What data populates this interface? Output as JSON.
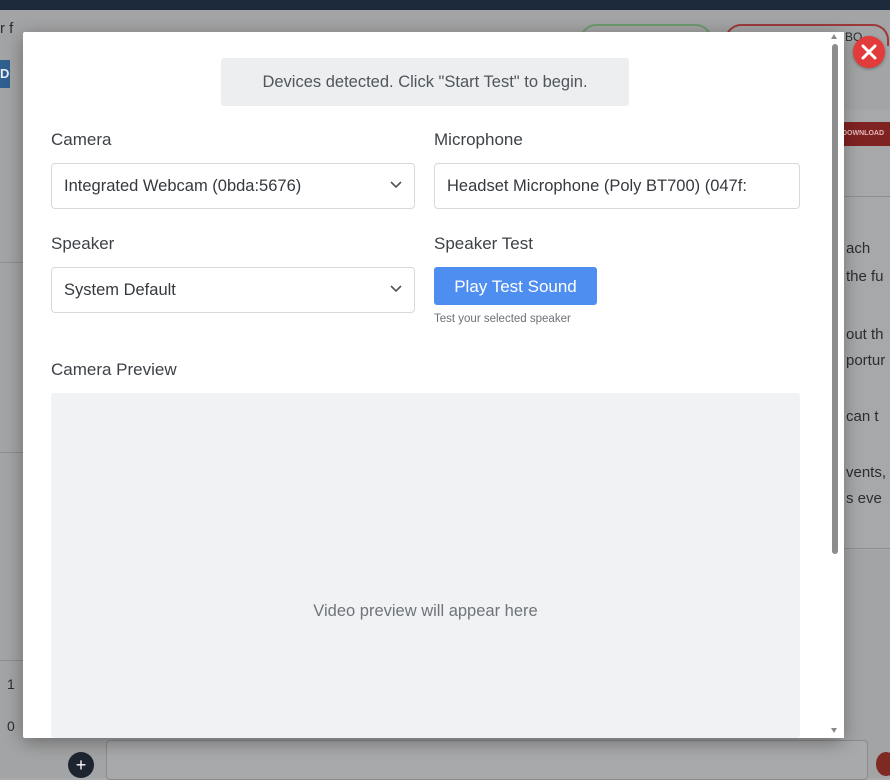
{
  "background": {
    "left_fragments": [
      "r f",
      "DC",
      "1",
      "0"
    ],
    "right_fragments": [
      "ach",
      "the fu",
      "out th",
      "portur",
      "can t",
      "vents,",
      "s eve"
    ],
    "download_label": "DOWNLOAD",
    "top_right_fragment": "BO"
  },
  "modal": {
    "banner_text": "Devices detected. Click \"Start Test\" to begin.",
    "camera": {
      "label": "Camera",
      "selected": "Integrated Webcam (0bda:5676)"
    },
    "microphone": {
      "label": "Microphone",
      "selected": "Headset Microphone (Poly BT700) (047f:"
    },
    "speaker": {
      "label": "Speaker",
      "selected": "System Default"
    },
    "speaker_test": {
      "label": "Speaker Test",
      "button_label": "Play Test Sound",
      "hint": "Test your selected speaker"
    },
    "camera_preview": {
      "label": "Camera Preview",
      "placeholder": "Video preview will appear here"
    }
  },
  "colors": {
    "accent_button": "#4f8ef1",
    "close_button": "#e23b3b",
    "overlay_bg": "#a3a4a5"
  }
}
